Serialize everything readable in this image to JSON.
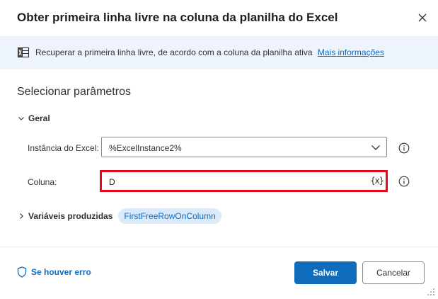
{
  "dialog": {
    "title": "Obter primeira linha livre na coluna da planilha do Excel",
    "close_icon": "close-icon"
  },
  "info_bar": {
    "icon": "excel-sheet-icon",
    "text": "Recuperar a primeira linha livre, de acordo com a coluna da planilha ativa",
    "link": "Mais informações"
  },
  "parameters": {
    "title": "Selecionar parâmetros",
    "group_label": "Geral",
    "excel_instance": {
      "label": "Instância do Excel:",
      "value": "%ExcelInstance2%"
    },
    "column": {
      "label": "Coluna:",
      "value": "D",
      "variable_button": "{x}"
    }
  },
  "produced_variables": {
    "label": "Variáveis produzidas",
    "variables": [
      "FirstFreeRowOnColumn"
    ]
  },
  "footer": {
    "on_error_label": "Se houver erro",
    "save_label": "Salvar",
    "cancel_label": "Cancelar"
  },
  "colors": {
    "accent": "#0f6cbd",
    "info_bar_bg": "#eef4fb",
    "highlight_border": "#e00b1c",
    "chip_bg": "#dce9f8"
  }
}
